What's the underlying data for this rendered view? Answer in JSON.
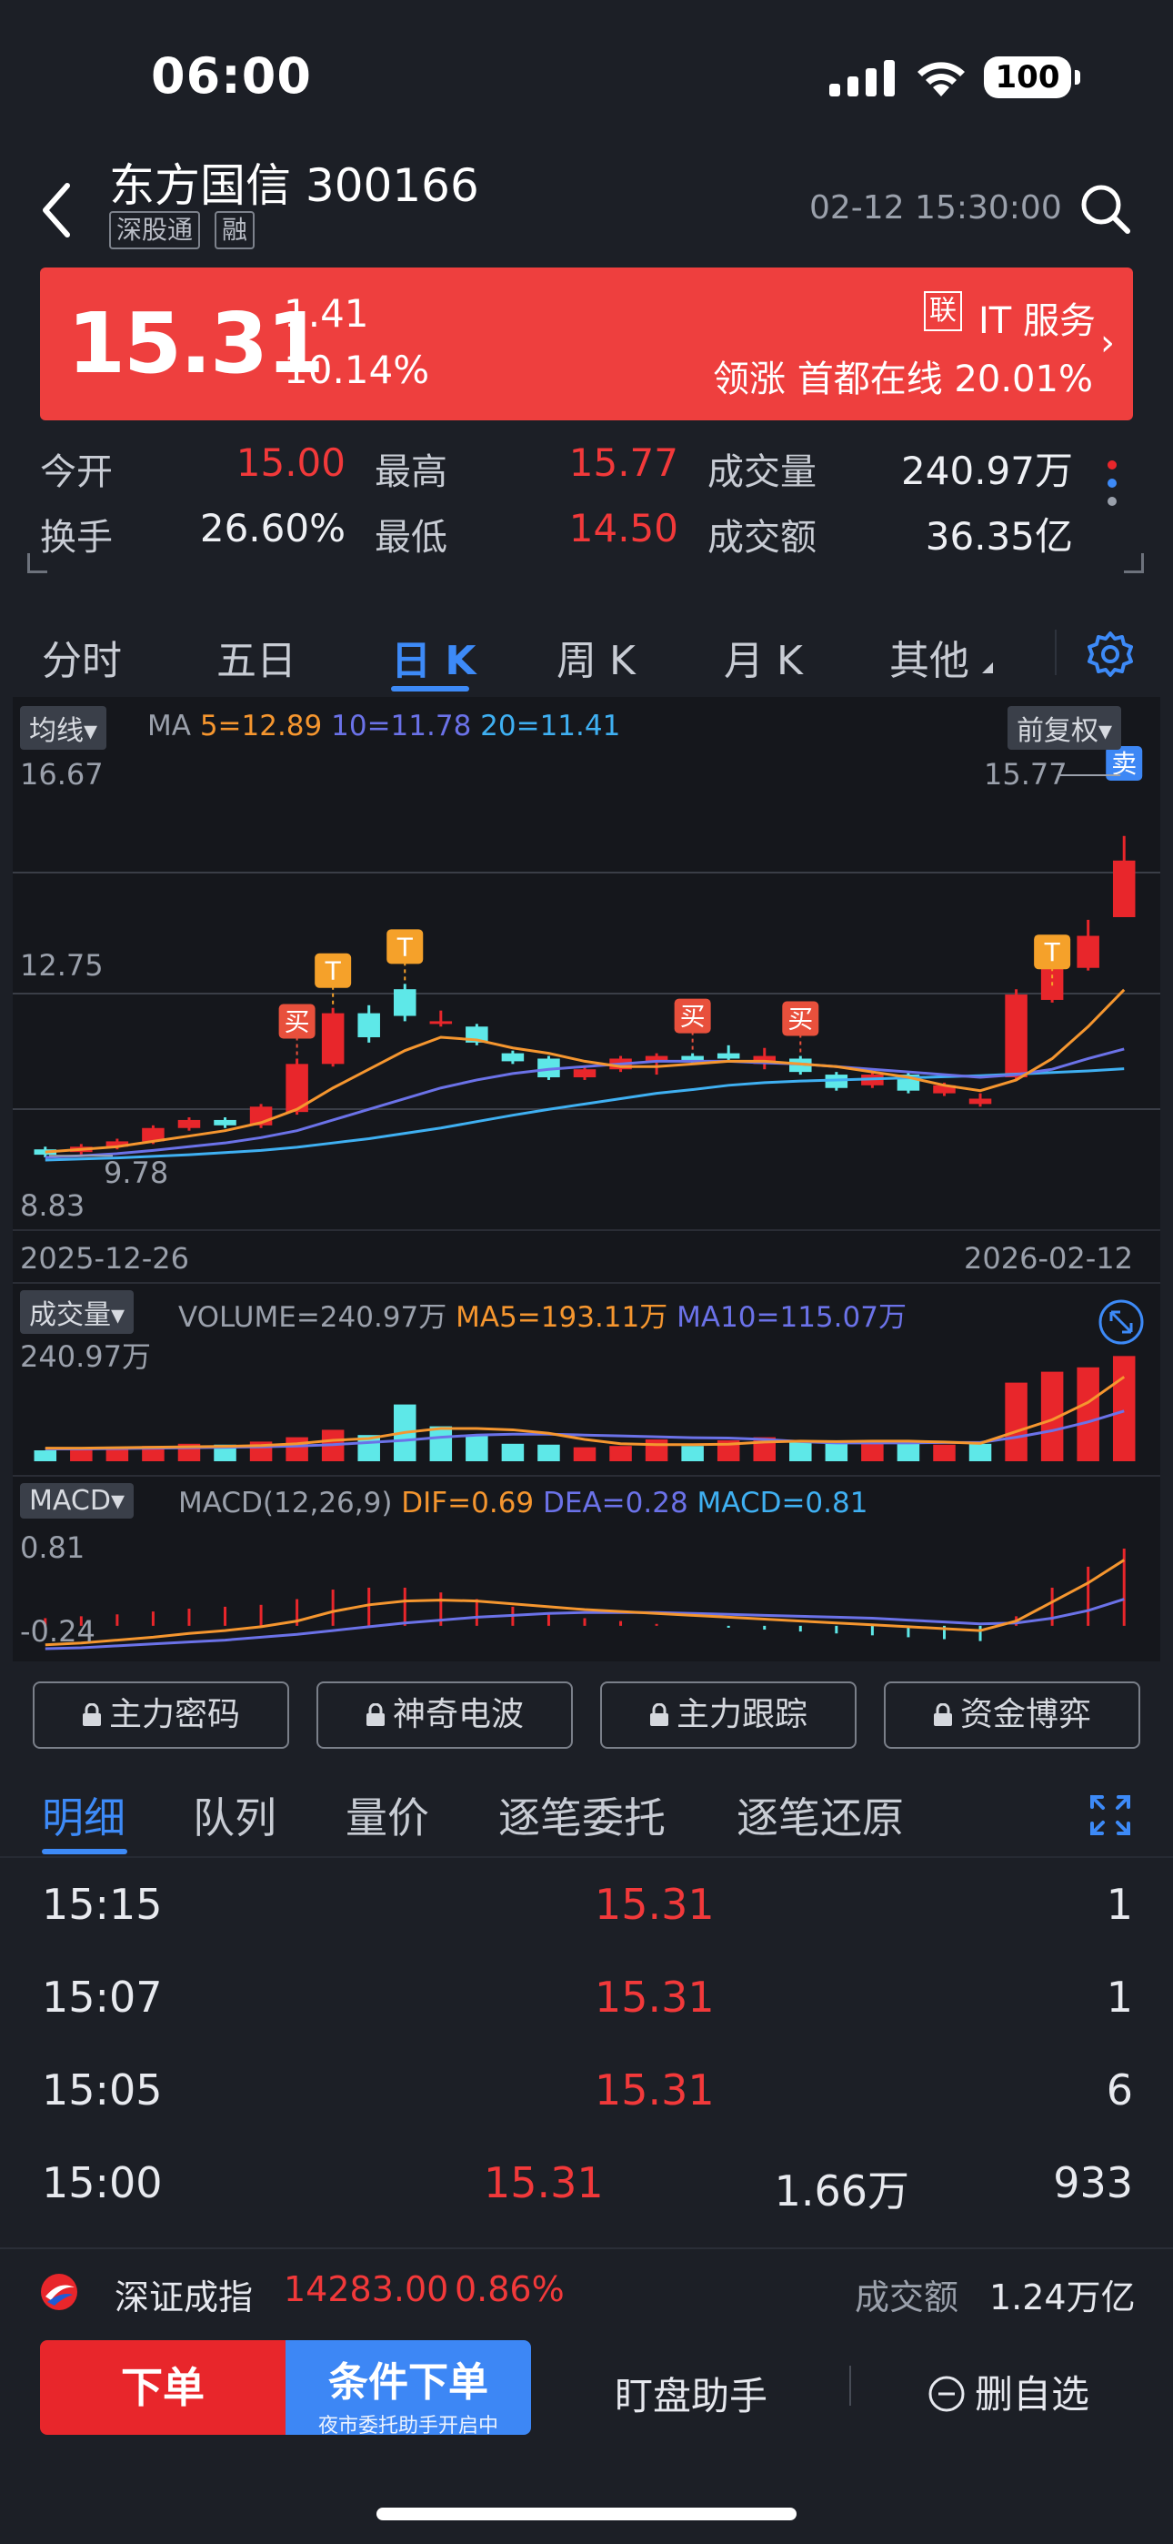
{
  "status_bar": {
    "time": "06:00",
    "battery": "100"
  },
  "header": {
    "title": "东方国信 300166",
    "tags": [
      "深股通",
      "融"
    ],
    "datetime": "02-12 15:30:00"
  },
  "price_banner": {
    "price": "15.31",
    "change": "1.41",
    "change_pct": "10.14%",
    "sector_tag": "联",
    "sector_name": "IT 服务",
    "leader_text": "领涨 首都在线 20.01%"
  },
  "quote": {
    "open_label": "今开",
    "open": "15.00",
    "high_label": "最高",
    "high": "15.77",
    "volume_label": "成交量",
    "volume": "240.97万",
    "turnover_label": "换手",
    "turnover": "26.60%",
    "low_label": "最低",
    "low": "14.50",
    "amount_label": "成交额",
    "amount": "36.35亿"
  },
  "kline_tabs": [
    "分时",
    "五日",
    "日 K",
    "周 K",
    "月 K",
    "其他"
  ],
  "active_kline_tab": 2,
  "chart": {
    "ma_chip": "均线",
    "ma_label": "MA",
    "ma5": "5=12.89",
    "ma10": "10=11.78",
    "ma20": "20=11.41",
    "adjust_chip": "前复权",
    "y_top": "16.67",
    "y_mid": "12.75",
    "y_low": "8.83",
    "max_marker": "15.77",
    "min_marker": "9.78",
    "sell_marker": "卖",
    "buy_marker": "买",
    "t_marker": "T",
    "date_start": "2025-12-26",
    "date_end": "2026-02-12",
    "vol_chip": "成交量",
    "vol_text": "VOLUME=240.97万",
    "vol_ma5": "MA5=193.11万",
    "vol_ma10": "MA10=115.07万",
    "vol_top": "240.97万",
    "macd_chip": "MACD",
    "macd_text": "MACD(12,26,9)",
    "dif": "DIF=0.69",
    "dea": "DEA=0.28",
    "macd_val": "MACD=0.81",
    "macd_top": "0.81",
    "macd_low": "-0.24",
    "colors": {
      "up": "#e8262b",
      "down": "#5ee8e8",
      "ma5": "#f5962f",
      "ma10": "#6b72e8",
      "ma20": "#3fb0f2"
    }
  },
  "chart_data": {
    "type": "candlestick",
    "candles": [
      {
        "o": 9.9,
        "c": 9.8,
        "h": 9.95,
        "l": 9.75
      },
      {
        "o": 9.85,
        "c": 9.95,
        "h": 10.0,
        "l": 9.8
      },
      {
        "o": 9.95,
        "c": 10.05,
        "h": 10.1,
        "l": 9.9
      },
      {
        "o": 10.05,
        "c": 10.3,
        "h": 10.35,
        "l": 10.0
      },
      {
        "o": 10.3,
        "c": 10.45,
        "h": 10.5,
        "l": 10.25
      },
      {
        "o": 10.45,
        "c": 10.35,
        "h": 10.5,
        "l": 10.3
      },
      {
        "o": 10.35,
        "c": 10.7,
        "h": 10.75,
        "l": 10.3
      },
      {
        "o": 10.6,
        "c": 11.5,
        "h": 11.6,
        "l": 10.55
      },
      {
        "o": 11.5,
        "c": 12.45,
        "h": 12.55,
        "l": 11.45
      },
      {
        "o": 12.45,
        "c": 12.0,
        "h": 12.6,
        "l": 11.9
      },
      {
        "o": 12.9,
        "c": 12.4,
        "h": 13.0,
        "l": 12.3
      },
      {
        "o": 12.3,
        "c": 12.3,
        "h": 12.5,
        "l": 12.2
      },
      {
        "o": 12.2,
        "c": 11.9,
        "h": 12.25,
        "l": 11.85
      },
      {
        "o": 11.7,
        "c": 11.55,
        "h": 11.75,
        "l": 11.5
      },
      {
        "o": 11.6,
        "c": 11.25,
        "h": 11.65,
        "l": 11.2
      },
      {
        "o": 11.25,
        "c": 11.4,
        "h": 11.45,
        "l": 11.2
      },
      {
        "o": 11.4,
        "c": 11.6,
        "h": 11.65,
        "l": 11.35
      },
      {
        "o": 11.55,
        "c": 11.65,
        "h": 11.7,
        "l": 11.3
      },
      {
        "o": 11.65,
        "c": 11.55,
        "h": 11.7,
        "l": 11.5
      },
      {
        "o": 11.7,
        "c": 11.6,
        "h": 11.85,
        "l": 11.55
      },
      {
        "o": 11.5,
        "c": 11.65,
        "h": 11.8,
        "l": 11.4
      },
      {
        "o": 11.6,
        "c": 11.35,
        "h": 11.65,
        "l": 11.3
      },
      {
        "o": 11.3,
        "c": 11.05,
        "h": 11.35,
        "l": 11.0
      },
      {
        "o": 11.1,
        "c": 11.3,
        "h": 11.35,
        "l": 11.05
      },
      {
        "o": 11.3,
        "c": 11.0,
        "h": 11.35,
        "l": 10.95
      },
      {
        "o": 10.95,
        "c": 11.1,
        "h": 11.15,
        "l": 10.9
      },
      {
        "o": 10.75,
        "c": 10.85,
        "h": 10.95,
        "l": 10.7
      },
      {
        "o": 11.25,
        "c": 12.8,
        "h": 12.9,
        "l": 11.2
      },
      {
        "o": 12.7,
        "c": 13.3,
        "h": 13.5,
        "l": 12.65
      },
      {
        "o": 13.3,
        "c": 13.9,
        "h": 14.2,
        "l": 13.25
      },
      {
        "o": 14.25,
        "c": 15.31,
        "h": 15.77,
        "l": 14.5
      }
    ],
    "ma5": [
      9.85,
      9.9,
      9.95,
      10.05,
      10.15,
      10.25,
      10.4,
      10.65,
      11.05,
      11.4,
      11.75,
      12.0,
      11.95,
      11.8,
      11.7,
      11.55,
      11.45,
      11.45,
      11.5,
      11.55,
      11.55,
      11.5,
      11.45,
      11.35,
      11.25,
      11.1,
      11.0,
      11.2,
      11.6,
      12.2,
      12.89
    ],
    "ma10": [
      9.75,
      9.78,
      9.82,
      9.88,
      9.95,
      10.02,
      10.12,
      10.25,
      10.45,
      10.65,
      10.85,
      11.05,
      11.2,
      11.32,
      11.4,
      11.45,
      11.5,
      11.55,
      11.55,
      11.55,
      11.52,
      11.5,
      11.45,
      11.4,
      11.35,
      11.3,
      11.25,
      11.3,
      11.4,
      11.6,
      11.78
    ],
    "ma20": [
      9.7,
      9.72,
      9.74,
      9.77,
      9.8,
      9.84,
      9.88,
      9.94,
      10.02,
      10.1,
      10.2,
      10.3,
      10.42,
      10.54,
      10.65,
      10.75,
      10.85,
      10.95,
      11.02,
      11.1,
      11.15,
      11.18,
      11.2,
      11.22,
      11.24,
      11.26,
      11.28,
      11.31,
      11.34,
      11.37,
      11.41
    ],
    "volume": [
      25,
      28,
      30,
      35,
      40,
      38,
      45,
      55,
      72,
      60,
      130,
      80,
      58,
      40,
      38,
      32,
      35,
      50,
      35,
      48,
      55,
      45,
      42,
      40,
      45,
      38,
      40,
      180,
      205,
      215,
      240.97
    ],
    "vol_up": [
      false,
      true,
      true,
      true,
      true,
      false,
      true,
      true,
      true,
      false,
      false,
      false,
      false,
      false,
      false,
      true,
      true,
      true,
      false,
      true,
      true,
      false,
      false,
      true,
      false,
      true,
      false,
      true,
      true,
      true,
      true
    ],
    "vol_ma5": [
      30,
      30,
      31,
      32,
      33,
      34,
      36,
      40,
      48,
      52,
      66,
      75,
      75,
      72,
      64,
      50,
      40,
      38,
      38,
      39,
      44,
      46,
      45,
      46,
      46,
      44,
      41,
      68,
      95,
      135,
      193.11
    ],
    "vol_ma10": [
      28,
      28,
      29,
      30,
      31,
      32,
      33,
      35,
      38,
      43,
      48,
      55,
      60,
      62,
      62,
      60,
      58,
      56,
      54,
      53,
      50,
      45,
      42,
      42,
      42,
      43,
      43,
      55,
      70,
      90,
      115.07
    ],
    "macd_hist": [
      0.08,
      0.1,
      0.12,
      0.15,
      0.18,
      0.2,
      0.22,
      0.28,
      0.38,
      0.4,
      0.4,
      0.35,
      0.28,
      0.2,
      0.12,
      0.08,
      0.05,
      0.02,
      0.0,
      -0.02,
      -0.04,
      -0.06,
      -0.08,
      -0.1,
      -0.12,
      -0.14,
      -0.16,
      0.1,
      0.4,
      0.62,
      0.81
    ],
    "dif": [
      -0.2,
      -0.18,
      -0.15,
      -0.12,
      -0.08,
      -0.05,
      -0.01,
      0.05,
      0.15,
      0.22,
      0.26,
      0.27,
      0.26,
      0.23,
      0.2,
      0.17,
      0.15,
      0.13,
      0.11,
      0.09,
      0.07,
      0.05,
      0.03,
      0.01,
      -0.01,
      -0.03,
      -0.05,
      0.05,
      0.25,
      0.45,
      0.69
    ],
    "dea": [
      -0.24,
      -0.23,
      -0.21,
      -0.19,
      -0.17,
      -0.15,
      -0.12,
      -0.09,
      -0.05,
      -0.01,
      0.03,
      0.06,
      0.09,
      0.11,
      0.13,
      0.14,
      0.14,
      0.14,
      0.13,
      0.12,
      0.11,
      0.1,
      0.09,
      0.08,
      0.06,
      0.04,
      0.02,
      0.03,
      0.08,
      0.16,
      0.28
    ],
    "ylim": [
      8.83,
      16.67
    ],
    "macd_ylim": [
      -0.24,
      0.81
    ]
  },
  "indicator_buttons": [
    "主力密码",
    "神奇电波",
    "主力跟踪",
    "资金博弈"
  ],
  "detail_tabs": [
    "明细",
    "队列",
    "量价",
    "逐笔委托",
    "逐笔还原"
  ],
  "ticks": [
    {
      "time": "15:15",
      "price": "15.31",
      "amount": "",
      "vol": "1"
    },
    {
      "time": "15:07",
      "price": "15.31",
      "amount": "",
      "vol": "1"
    },
    {
      "time": "15:05",
      "price": "15.31",
      "amount": "",
      "vol": "6"
    },
    {
      "time": "15:00",
      "price": "15.31",
      "amount": "1.66万",
      "vol": "933"
    }
  ],
  "index_bar": {
    "name": "深证成指",
    "value": "14283.00",
    "pct": "0.86%",
    "amount_label": "成交额",
    "amount": "1.24万亿"
  },
  "bottom_bar": {
    "order": "下单",
    "cond_order": "条件下单",
    "cond_sub": "夜市委托助手开启中",
    "watch": "盯盘助手",
    "remove": "删自选"
  }
}
